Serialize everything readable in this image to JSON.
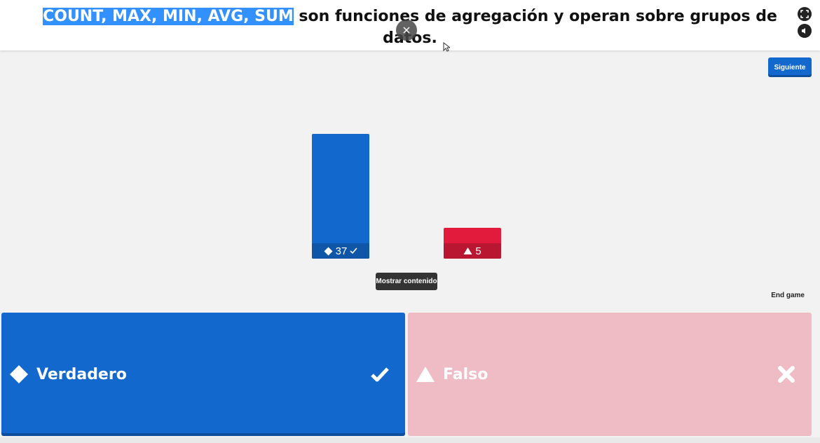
{
  "question": {
    "highlighted": "COUNT, MAX, MIN, AVG, SUM",
    "rest": " son funciones de agregación y operan sobre grupos de datos."
  },
  "top_icons": [
    "fullscreen-icon",
    "volume-icon"
  ],
  "next_button": "Siguiente",
  "chart_data": {
    "type": "bar",
    "categories": [
      "Verdadero",
      "Falso"
    ],
    "values": [
      37,
      5
    ],
    "correct": [
      true,
      false
    ],
    "colors": [
      "#1368ce",
      "#e21b3c"
    ],
    "icons": [
      "diamond",
      "triangle"
    ]
  },
  "show_content_button": "Mostrar contenido",
  "end_game": "End game",
  "answers": [
    {
      "label": "Verdadero",
      "shape": "diamond-icon",
      "mark": "check-icon",
      "correct": true,
      "color": "#1368ce"
    },
    {
      "label": "Falso",
      "shape": "triangle-icon",
      "mark": "cross-icon",
      "correct": false,
      "color": "#efbcc6"
    }
  ]
}
